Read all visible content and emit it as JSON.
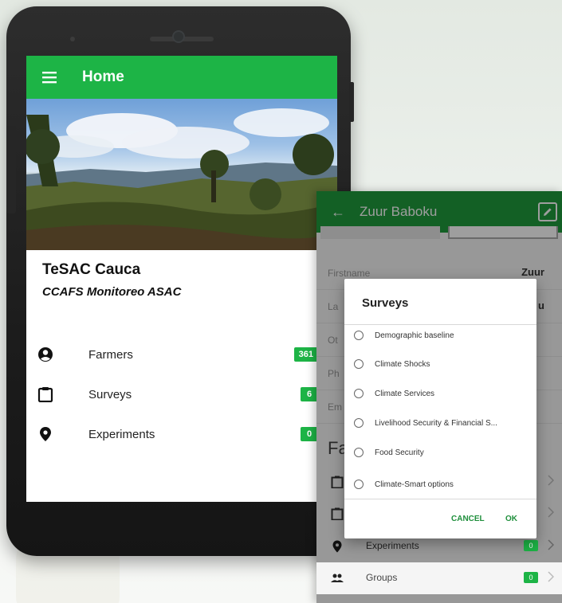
{
  "home": {
    "title": "Home",
    "org_name": "TeSAC Cauca",
    "org_subtitle": "CCAFS Monitoreo ASAC",
    "menu": [
      {
        "label": "Farmers",
        "badge": "361"
      },
      {
        "label": "Surveys",
        "badge": "6"
      },
      {
        "label": "Experiments",
        "badge": "0"
      }
    ]
  },
  "farmer": {
    "title": "Zuur Baboku",
    "fields": [
      {
        "label": "Firstname",
        "value": "Zuur"
      },
      {
        "label": "La",
        "value": "u"
      },
      {
        "label": "Ot",
        "value": ""
      },
      {
        "label": "Ph",
        "value": ""
      },
      {
        "label": "Em",
        "value": ""
      }
    ],
    "section": "Fa",
    "items": [
      {
        "label": "Experiments",
        "badge": "0"
      },
      {
        "label": "Groups",
        "badge": "0"
      }
    ]
  },
  "dialog": {
    "title": "Surveys",
    "options": [
      "Demographic baseline",
      "Climate Shocks",
      "Climate Services",
      "Livelihood Security & Financial S...",
      "Food Security",
      "Climate-Smart options"
    ],
    "cancel": "CANCEL",
    "ok": "OK"
  },
  "colors": {
    "accent": "#1db446",
    "toolbar_dark": "#1f9b3c"
  }
}
